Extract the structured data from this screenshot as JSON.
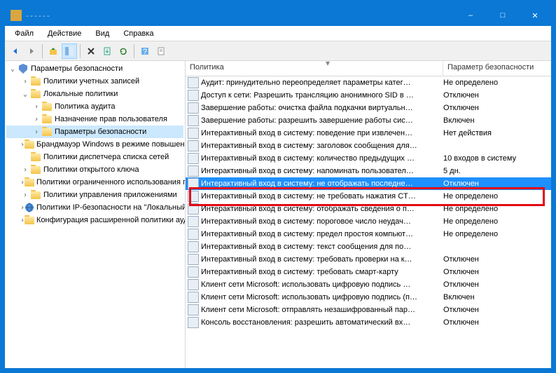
{
  "window": {
    "title": "------",
    "minimize": "–",
    "maximize": "□",
    "close": "✕"
  },
  "menu": {
    "file": "Файл",
    "action": "Действие",
    "view": "Вид",
    "help": "Справка"
  },
  "tree": {
    "root": "Параметры безопасности",
    "items": [
      {
        "label": "Политики учетных записей",
        "depth": 1,
        "expand": "›"
      },
      {
        "label": "Локальные политики",
        "depth": 1,
        "expand": "⌄"
      },
      {
        "label": "Политика аудита",
        "depth": 2,
        "expand": "›"
      },
      {
        "label": "Назначение прав пользователя",
        "depth": 2,
        "expand": "›"
      },
      {
        "label": "Параметры безопасности",
        "depth": 2,
        "expand": "›",
        "selected": true
      },
      {
        "label": "Брандмауэр Windows в режиме повышенной безопасности",
        "depth": 1,
        "expand": "›"
      },
      {
        "label": "Политики диспетчера списка сетей",
        "depth": 1,
        "expand": ""
      },
      {
        "label": "Политики открытого ключа",
        "depth": 1,
        "expand": "›"
      },
      {
        "label": "Политики ограниченного использования программ",
        "depth": 1,
        "expand": "›"
      },
      {
        "label": "Политики управления приложениями",
        "depth": 1,
        "expand": "›"
      },
      {
        "label": "Политики IP-безопасности на \"Локальный компьютер\"",
        "depth": 1,
        "expand": "›",
        "icon": "globe"
      },
      {
        "label": "Конфигурация расширенной политики аудита",
        "depth": 1,
        "expand": "›"
      }
    ]
  },
  "list": {
    "header": {
      "policy": "Политика",
      "value": "Параметр безопасности"
    },
    "rows": [
      {
        "label": "Аудит: принудительно переопределяет параметры катег…",
        "value": "Не определено"
      },
      {
        "label": "Доступ к сети: Разрешить трансляцию анонимного SID в …",
        "value": "Отключен"
      },
      {
        "label": "Завершение работы: очистка файла подкачки виртуальн…",
        "value": "Отключен"
      },
      {
        "label": "Завершение работы: разрешить завершение работы сис…",
        "value": "Включен"
      },
      {
        "label": "Интерактивный вход в систему: поведение при извлечен…",
        "value": "Нет действия"
      },
      {
        "label": "Интерактивный вход в систему: заголовок сообщения для…",
        "value": ""
      },
      {
        "label": "Интерактивный вход в систему: количество предыдущих …",
        "value": "10 входов в систему"
      },
      {
        "label": "Интерактивный вход в систему: напоминать пользовател…",
        "value": "5 дн."
      },
      {
        "label": "Интерактивный вход в систему: не отображать последне…",
        "value": "Отключен",
        "highlight": true
      },
      {
        "label": "Интерактивный вход в систему: не требовать нажатия CT…",
        "value": "Не определено"
      },
      {
        "label": "Интерактивный вход в систему: отображать сведения о п…",
        "value": "Не определено"
      },
      {
        "label": "Интерактивный вход в систему: пороговое число неудач…",
        "value": "Не определено"
      },
      {
        "label": "Интерактивный вход в систему: предел простоя компьют…",
        "value": "Не определено"
      },
      {
        "label": "Интерактивный вход в систему: текст сообщения для по…",
        "value": ""
      },
      {
        "label": "Интерактивный вход в систему: требовать проверки на к…",
        "value": "Отключен"
      },
      {
        "label": "Интерактивный вход в систему: требовать смарт-карту",
        "value": "Отключен"
      },
      {
        "label": "Клиент сети Microsoft: использовать цифровую подпись …",
        "value": "Отключен"
      },
      {
        "label": "Клиент сети Microsoft: использовать цифровую подпись (п…",
        "value": "Включен"
      },
      {
        "label": "Клиент сети Microsoft: отправлять незашифрованный пар…",
        "value": "Отключен"
      },
      {
        "label": "Консоль восстановления: разрешить автоматический вх…",
        "value": "Отключен"
      }
    ]
  }
}
